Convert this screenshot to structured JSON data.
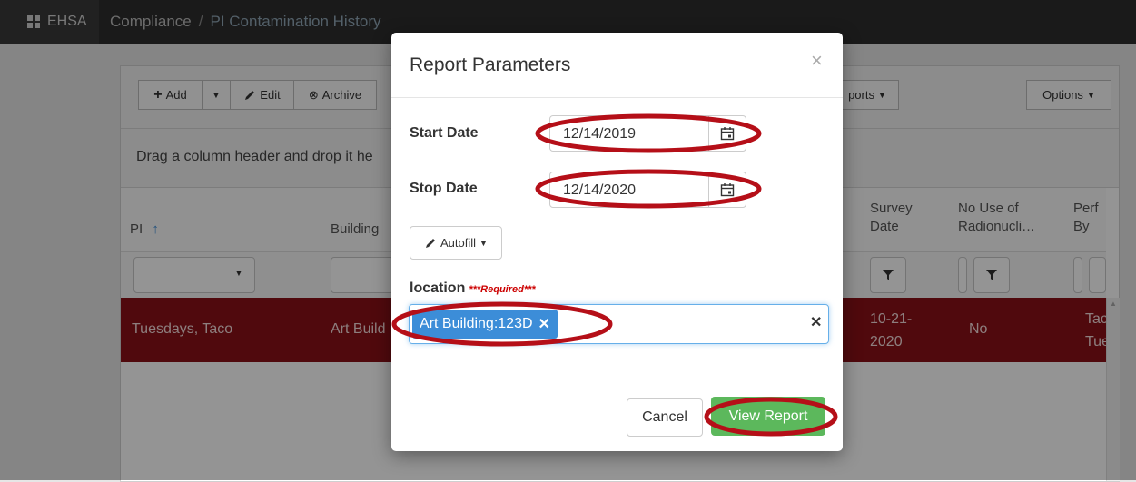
{
  "topbar": {
    "brand": "EHSA",
    "crumb_section": "Compliance",
    "crumb_sep": "/",
    "crumb_current": "PI Contamination History"
  },
  "toolbar": {
    "add": "Add",
    "edit": "Edit",
    "archive": "Archive",
    "reports": "ports",
    "options": "Options"
  },
  "grid": {
    "hint": "Drag a column header and drop it he",
    "headers": {
      "pi": "PI",
      "building": "Building",
      "survey_date_1": "Survey",
      "survey_date_2": "Date",
      "no_use_1": "No Use of",
      "no_use_2": "Radionucli…",
      "perf_1": "Perf",
      "perf_2": "By"
    },
    "row": {
      "pi": "Tuesdays, Taco",
      "building": "Art Build",
      "survey_1": "10-21-",
      "survey_2": "2020",
      "no_use": "No",
      "perf_1": "Tac",
      "perf_2": "Tue"
    }
  },
  "modal": {
    "title": "Report Parameters",
    "close": "×",
    "start_label": "Start Date",
    "start_value": "12/14/2019",
    "stop_label": "Stop Date",
    "stop_value": "12/14/2020",
    "autofill": "Autofill",
    "location_label": "location",
    "location_required": "***Required***",
    "location_chip": "Art Building:123D",
    "chip_remove": "✕",
    "clear_all": "✕",
    "cancel": "Cancel",
    "view_report": "View Report"
  },
  "colors": {
    "topbar": "#2d2d2d",
    "row_selected": "#8b1117",
    "chip": "#3c8dd8",
    "primary": "#5cb85c",
    "annotation": "#b50f18"
  }
}
